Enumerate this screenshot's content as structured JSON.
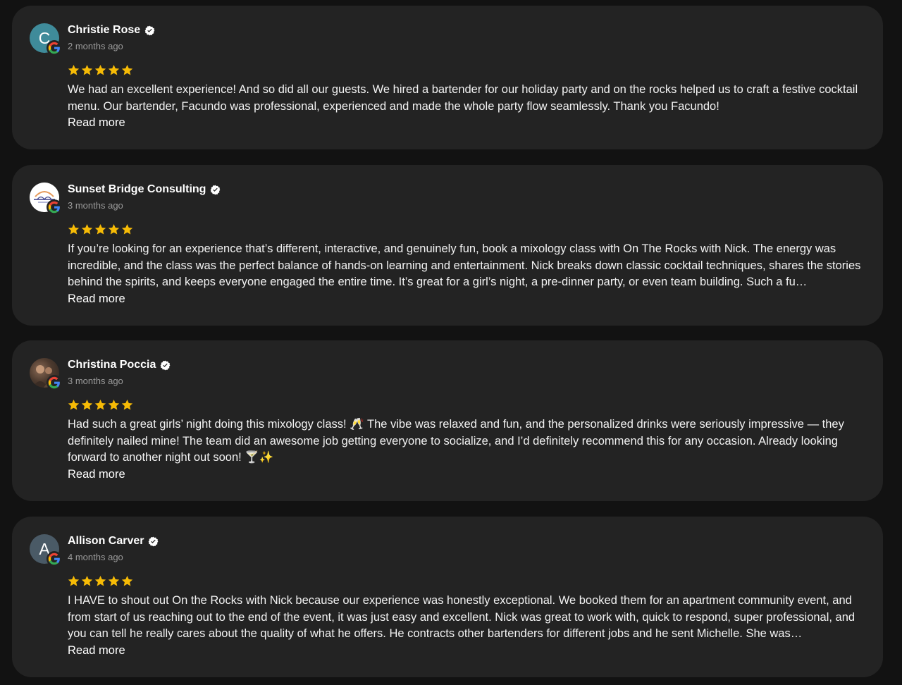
{
  "reviews": [
    {
      "name": "Christie Rose",
      "time": "2 months ago",
      "avatar_letter": "C",
      "avatar_color": "#3f8b9a",
      "rating": 5,
      "text": "We had an excellent experience! And so did all our guests. We hired a bartender for our holiday party and on the rocks helped us to craft a festive cocktail menu. Our bartender, Facundo was professional, experienced and made the whole party flow seamlessly. Thank you Facundo!",
      "read_more": "Read more"
    },
    {
      "name": "Sunset Bridge Consulting",
      "time": "3 months ago",
      "avatar_letter": "",
      "avatar_color": "#ffffff",
      "rating": 5,
      "text": "If you’re looking for an experience that’s different, interactive, and genuinely fun, book a mixology class with On The Rocks with Nick. The energy was incredible, and the class was the perfect balance of hands-on learning and entertainment. Nick breaks down classic cocktail techniques, shares the stories behind the spirits, and keeps everyone engaged the entire time. It’s great for a girl’s night, a pre-dinner party, or even team building. Such a fu…",
      "read_more": "Read more"
    },
    {
      "name": "Christina Poccia",
      "time": "3 months ago",
      "avatar_letter": "",
      "avatar_color": "#4d3a2e",
      "rating": 5,
      "text": "Had such a great girls’ night doing this mixology class! 🥂 The vibe was relaxed and fun, and the personalized drinks were seriously impressive — they definitely nailed mine! The team did an awesome job getting everyone to socialize, and I’d definitely recommend this for any occasion. Already looking forward to another night out soon! 🍸✨",
      "read_more": "Read more"
    },
    {
      "name": "Allison Carver",
      "time": "4 months ago",
      "avatar_letter": "A",
      "avatar_color": "#4a5a66",
      "rating": 5,
      "text": "I HAVE to shout out On the Rocks with Nick because our experience was honestly exceptional. We booked them for an apartment community event, and from start of us reaching out to the end of the event, it was just easy and excellent. Nick was great to work with, quick to respond, super professional, and you can tell he really cares about the quality of what he offers. He contracts other bartenders for different jobs and he sent Michelle. She was…",
      "read_more": "Read more"
    }
  ],
  "colors": {
    "background": "#121212",
    "card": "#232323",
    "star": "#f6bb06",
    "timestamp": "#9a9a9a"
  }
}
